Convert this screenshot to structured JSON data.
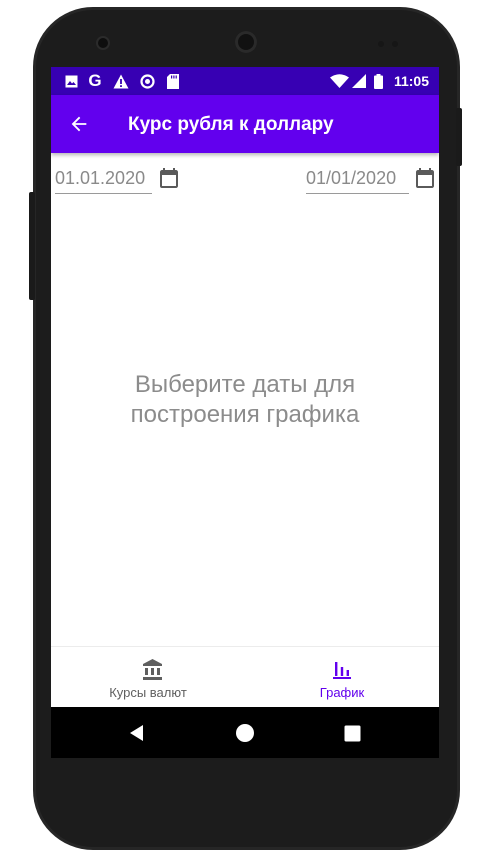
{
  "status_bar": {
    "time": "11:05",
    "left_icons": [
      "image-notification-icon",
      "google-icon",
      "warning-icon",
      "circle-notification-icon",
      "sd-card-icon"
    ],
    "right_icons": [
      "wifi-icon",
      "cell-signal-icon",
      "battery-icon"
    ]
  },
  "app_bar": {
    "title": "Курс рубля к доллару",
    "back_icon": "arrow-back-icon"
  },
  "date_from": {
    "value": "01.01.2020",
    "icon": "calendar-icon"
  },
  "date_to": {
    "value": "01/01/2020",
    "icon": "calendar-icon"
  },
  "placeholder": {
    "line1": "Выберите даты для",
    "line2": "построения графика"
  },
  "bottom_nav": {
    "items": [
      {
        "label": "Курсы валют",
        "icon": "bank-icon",
        "active": false
      },
      {
        "label": "График",
        "icon": "bar-chart-icon",
        "active": true
      }
    ],
    "active_color": "#6200EE",
    "inactive_color": "#5f5f5f"
  },
  "colors": {
    "primary": "#6200EE",
    "primary_dark": "#3700B3"
  }
}
